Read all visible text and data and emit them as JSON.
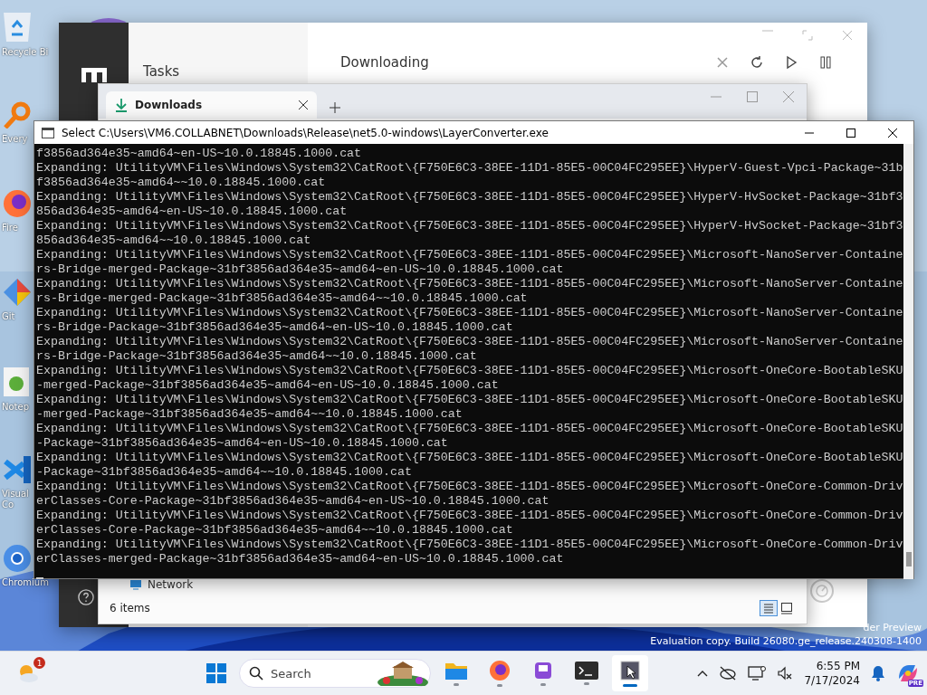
{
  "desktop_icons": [
    {
      "kind": "recycle",
      "label": "Recycle Bi"
    },
    {
      "kind": "search",
      "label": "Every"
    },
    {
      "kind": "firefox",
      "label": "Fire"
    },
    {
      "kind": "git",
      "label": "Git"
    },
    {
      "kind": "notepad",
      "label": "Notep"
    },
    {
      "kind": "vscode",
      "label": "Visual\nCo"
    },
    {
      "kind": "chromium",
      "label": "Chromium"
    }
  ],
  "motrix_window": {
    "sidebar_title": "Tasks",
    "heading": "Downloading"
  },
  "explorer_window": {
    "tab": "Downloads",
    "nav_item": "Network",
    "status": "6 items",
    "views": [
      {
        "kind": "details",
        "selected": true
      },
      {
        "kind": "tiles",
        "selected": false
      }
    ]
  },
  "console_window": {
    "title": "Select C:\\Users\\VM6.COLLABNET\\Downloads\\Release\\net5.0-windows\\LayerConverter.exe",
    "lines": [
      "f3856ad364e35~amd64~en-US~10.0.18845.1000.cat",
      "Expanding: UtilityVM\\Files\\Windows\\System32\\CatRoot\\{F750E6C3-38EE-11D1-85E5-00C04FC295EE}\\HyperV-Guest-Vpci-Package~31b",
      "f3856ad364e35~amd64~~10.0.18845.1000.cat",
      "Expanding: UtilityVM\\Files\\Windows\\System32\\CatRoot\\{F750E6C3-38EE-11D1-85E5-00C04FC295EE}\\HyperV-HvSocket-Package~31bf3",
      "856ad364e35~amd64~en-US~10.0.18845.1000.cat",
      "Expanding: UtilityVM\\Files\\Windows\\System32\\CatRoot\\{F750E6C3-38EE-11D1-85E5-00C04FC295EE}\\HyperV-HvSocket-Package~31bf3",
      "856ad364e35~amd64~~10.0.18845.1000.cat",
      "Expanding: UtilityVM\\Files\\Windows\\System32\\CatRoot\\{F750E6C3-38EE-11D1-85E5-00C04FC295EE}\\Microsoft-NanoServer-Containe",
      "rs-Bridge-merged-Package~31bf3856ad364e35~amd64~en-US~10.0.18845.1000.cat",
      "Expanding: UtilityVM\\Files\\Windows\\System32\\CatRoot\\{F750E6C3-38EE-11D1-85E5-00C04FC295EE}\\Microsoft-NanoServer-Containe",
      "rs-Bridge-merged-Package~31bf3856ad364e35~amd64~~10.0.18845.1000.cat",
      "Expanding: UtilityVM\\Files\\Windows\\System32\\CatRoot\\{F750E6C3-38EE-11D1-85E5-00C04FC295EE}\\Microsoft-NanoServer-Containe",
      "rs-Bridge-Package~31bf3856ad364e35~amd64~en-US~10.0.18845.1000.cat",
      "Expanding: UtilityVM\\Files\\Windows\\System32\\CatRoot\\{F750E6C3-38EE-11D1-85E5-00C04FC295EE}\\Microsoft-NanoServer-Containe",
      "rs-Bridge-Package~31bf3856ad364e35~amd64~~10.0.18845.1000.cat",
      "Expanding: UtilityVM\\Files\\Windows\\System32\\CatRoot\\{F750E6C3-38EE-11D1-85E5-00C04FC295EE}\\Microsoft-OneCore-BootableSKU",
      "-merged-Package~31bf3856ad364e35~amd64~en-US~10.0.18845.1000.cat",
      "Expanding: UtilityVM\\Files\\Windows\\System32\\CatRoot\\{F750E6C3-38EE-11D1-85E5-00C04FC295EE}\\Microsoft-OneCore-BootableSKU",
      "-merged-Package~31bf3856ad364e35~amd64~~10.0.18845.1000.cat",
      "Expanding: UtilityVM\\Files\\Windows\\System32\\CatRoot\\{F750E6C3-38EE-11D1-85E5-00C04FC295EE}\\Microsoft-OneCore-BootableSKU",
      "-Package~31bf3856ad364e35~amd64~en-US~10.0.18845.1000.cat",
      "Expanding: UtilityVM\\Files\\Windows\\System32\\CatRoot\\{F750E6C3-38EE-11D1-85E5-00C04FC295EE}\\Microsoft-OneCore-BootableSKU",
      "-Package~31bf3856ad364e35~amd64~~10.0.18845.1000.cat",
      "Expanding: UtilityVM\\Files\\Windows\\System32\\CatRoot\\{F750E6C3-38EE-11D1-85E5-00C04FC295EE}\\Microsoft-OneCore-Common-Driv",
      "erClasses-Core-Package~31bf3856ad364e35~amd64~en-US~10.0.18845.1000.cat",
      "Expanding: UtilityVM\\Files\\Windows\\System32\\CatRoot\\{F750E6C3-38EE-11D1-85E5-00C04FC295EE}\\Microsoft-OneCore-Common-Driv",
      "erClasses-Core-Package~31bf3856ad364e35~amd64~~10.0.18845.1000.cat",
      "Expanding: UtilityVM\\Files\\Windows\\System32\\CatRoot\\{F750E6C3-38EE-11D1-85E5-00C04FC295EE}\\Microsoft-OneCore-Common-Driv",
      "erClasses-merged-Package~31bf3856ad364e35~amd64~en-US~10.0.18845.1000.cat"
    ]
  },
  "watermark": [
    "der Preview",
    "Evaluation copy. Build 26080.ge_release.240308-1400"
  ],
  "taskbar": {
    "weather_badge": "1",
    "search_placeholder": "Search",
    "apps": [
      {
        "kind": "folder",
        "selected": false
      },
      {
        "kind": "firefox",
        "selected": false
      },
      {
        "kind": "app",
        "selected": false
      },
      {
        "kind": "terminal",
        "selected": false
      },
      {
        "kind": "console",
        "selected": true
      }
    ],
    "time": "6:55 PM",
    "date": "7/17/2024",
    "copilot_badge": "PRE"
  }
}
